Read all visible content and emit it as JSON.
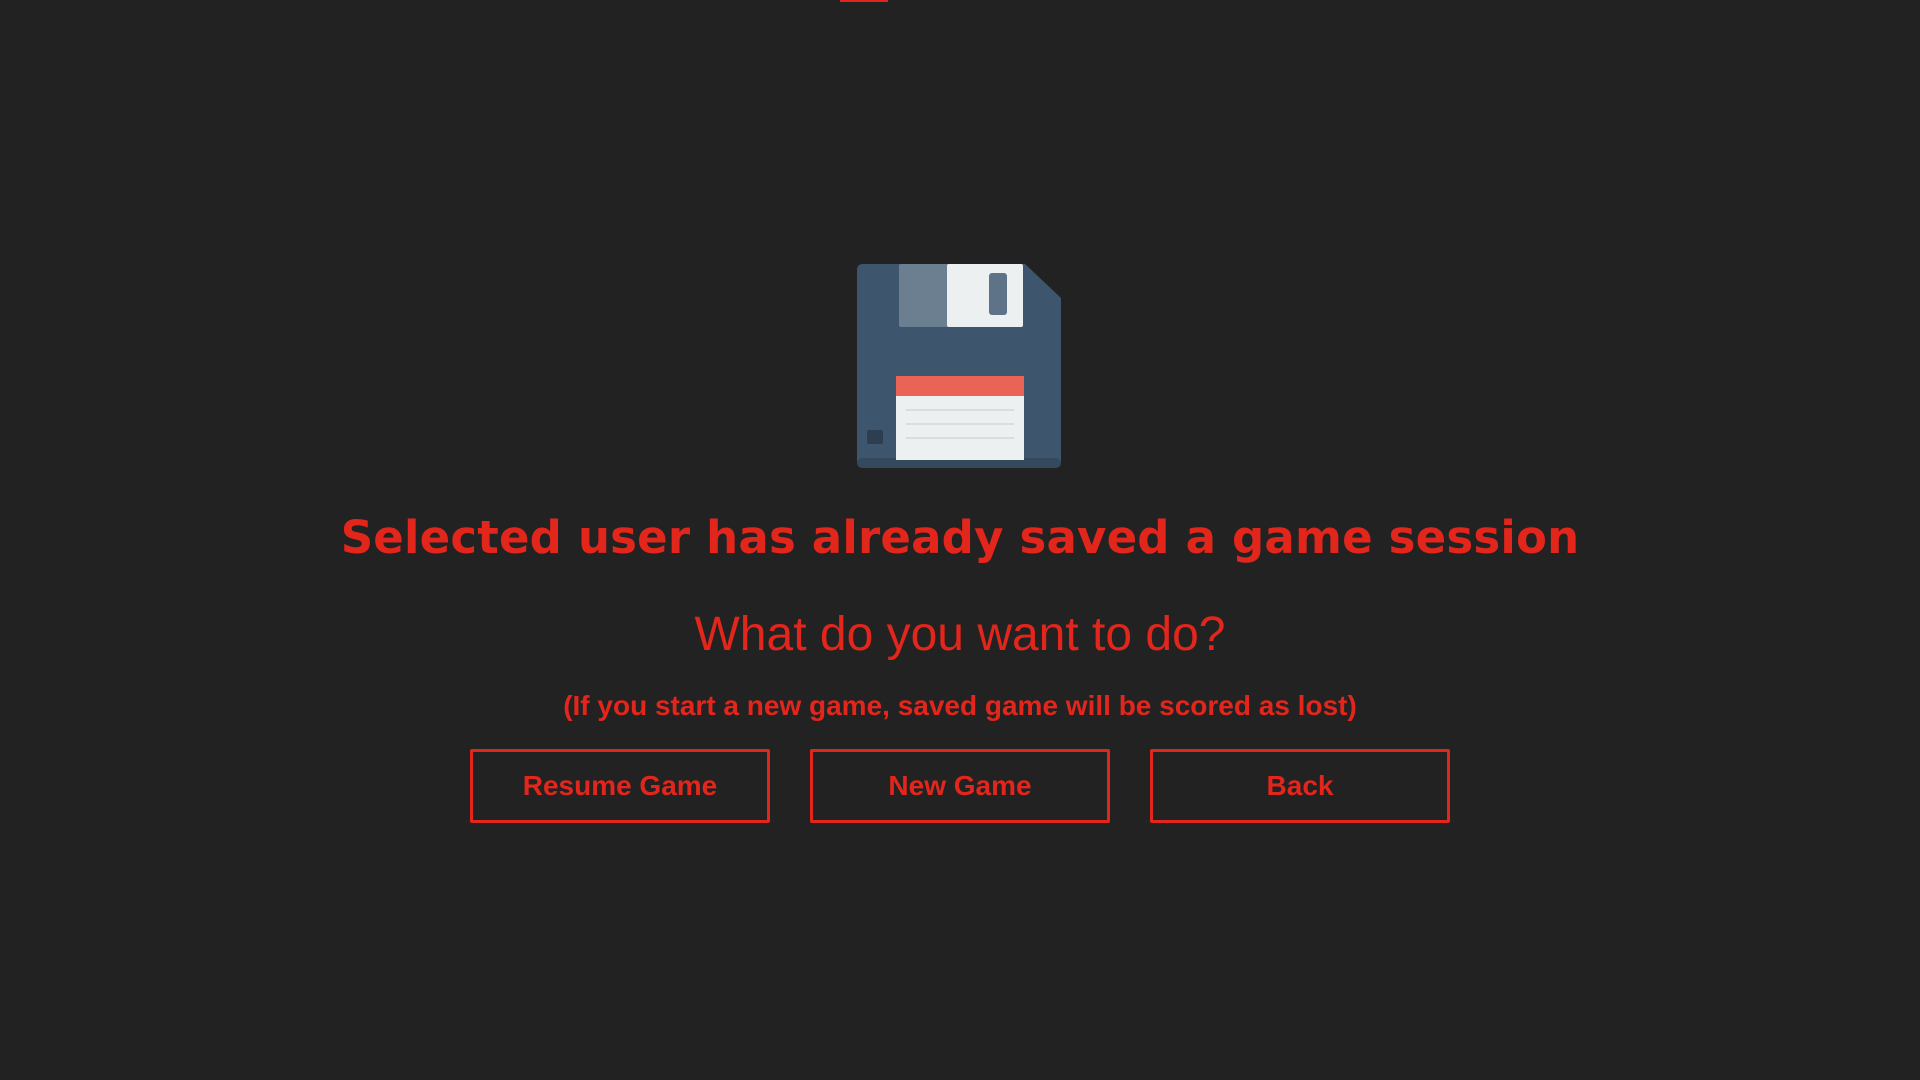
{
  "title": "Selected user has already saved a game session",
  "question": "What do you want to do?",
  "warning": "(If you start a new game, saved game will be scored as lost)",
  "buttons": {
    "resume": "Resume Game",
    "new_game": "New Game",
    "back": "Back"
  },
  "icon": "floppy-disk-icon",
  "colors": {
    "background": "#222222",
    "accent": "#e3261c",
    "disk_body": "#3d566e",
    "disk_label_red": "#e96356"
  }
}
